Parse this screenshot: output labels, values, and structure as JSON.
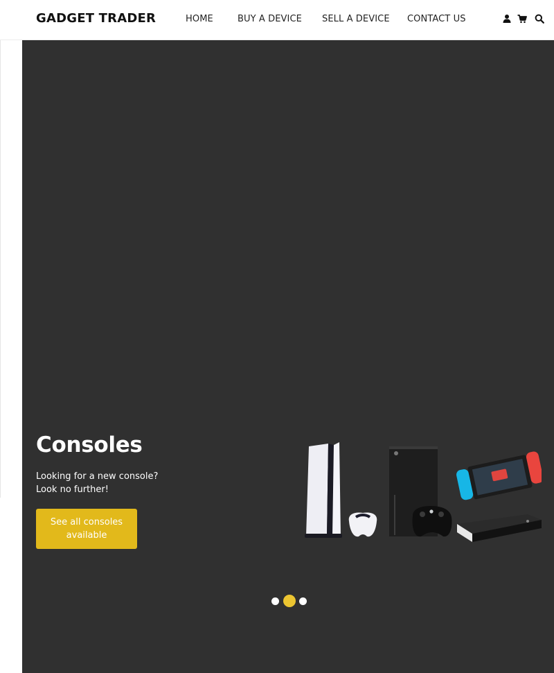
{
  "brand": {
    "name": "GADGET TRADER"
  },
  "nav": {
    "items": [
      {
        "label": "HOME"
      },
      {
        "label": "BUY A DEVICE"
      },
      {
        "label": "SELL A DEVICE"
      },
      {
        "label": "CONTACT US"
      }
    ],
    "icons": [
      "user-icon",
      "cart-icon",
      "search-icon"
    ]
  },
  "hero": {
    "title": "Consoles",
    "text_line1": "Looking for a new console?",
    "text_line2": "Look no further!",
    "cta_line1": "See all consoles",
    "cta_line2": "available",
    "slides_total": 3,
    "active_slide": 2
  },
  "colors": {
    "hero_bg": "#303030",
    "accent": "#e2b91b",
    "active_dot": "#ecc531",
    "nav_text": "#222222"
  }
}
